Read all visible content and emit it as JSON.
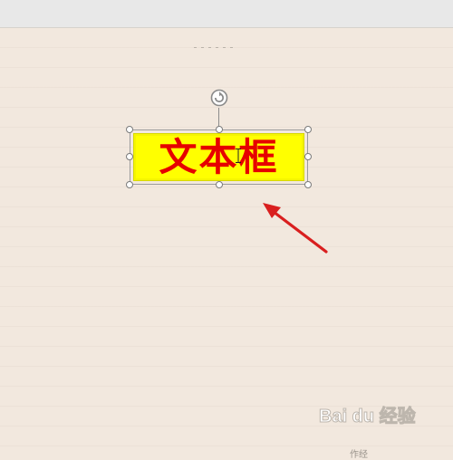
{
  "textbox": {
    "label": "文本框"
  },
  "colors": {
    "textbox_fill": "#ffff00",
    "textbox_text": "#e60000",
    "arrow": "#d91f1f",
    "page_background": "#f2e8de",
    "top_bar": "#e8e8e8"
  },
  "icons": {
    "rotate": "rotate-handle-icon",
    "cursor": "text-cursor-icon",
    "arrow": "red-arrow-annotation",
    "watermark": "baidu-jingyan-logo"
  },
  "watermark": {
    "logo_text": "Bai du 经验",
    "footer_text": "作经"
  }
}
